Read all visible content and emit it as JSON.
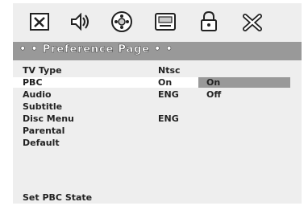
{
  "toolbar": {
    "icons": [
      "general-setup-icon",
      "audio-setup-icon",
      "video-setup-icon",
      "preference-page-icon",
      "password-lock-icon",
      "exit-icon"
    ]
  },
  "header": {
    "title": "• • Preference Page • •"
  },
  "menu": {
    "items": [
      {
        "label": "TV Type",
        "value": "Ntsc"
      },
      {
        "label": "PBC",
        "value": "On"
      },
      {
        "label": "Audio",
        "value": "ENG"
      },
      {
        "label": "Subtitle",
        "value": ""
      },
      {
        "label": "Disc Menu",
        "value": "ENG"
      },
      {
        "label": "Parental",
        "value": ""
      },
      {
        "label": "Default",
        "value": ""
      }
    ]
  },
  "options": [
    {
      "label": "On"
    },
    {
      "label": "Off"
    }
  ],
  "status": {
    "text": "Set PBC State"
  },
  "colors": {
    "background": "#eeeeee",
    "bar": "#999999",
    "highlight": "#ffffff",
    "text": "#222222"
  }
}
